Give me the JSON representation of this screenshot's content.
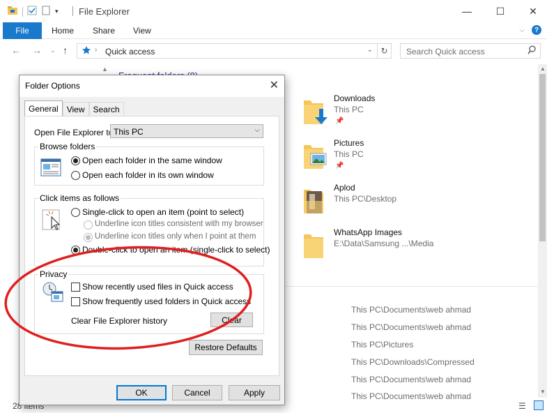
{
  "explorer": {
    "title": "File Explorer",
    "tabs": {
      "file": "File",
      "home": "Home",
      "share": "Share",
      "view": "View"
    },
    "address": "Quick access",
    "search_placeholder": "Search Quick access",
    "section_header": "Frequent folders (8)",
    "folders": [
      {
        "name": "Downloads",
        "path": "This PC",
        "pinned": true
      },
      {
        "name": "Pictures",
        "path": "This PC",
        "pinned": true
      },
      {
        "name": "Aplod",
        "path": "This PC\\Desktop",
        "pinned": false
      },
      {
        "name": "WhatsApp Images",
        "path": "E:\\Data\\Samsung ...\\Media",
        "pinned": false
      }
    ],
    "recent_paths": [
      "This PC\\Documents\\web ahmad",
      "This PC\\Documents\\web ahmad",
      "This PC\\Pictures",
      "This PC\\Downloads\\Compressed",
      "This PC\\Documents\\web ahmad",
      "This PC\\Documents\\web ahmad"
    ],
    "status": "28 items"
  },
  "dialog": {
    "title": "Folder Options",
    "tabs": [
      "General",
      "View",
      "Search"
    ],
    "active_tab": "General",
    "open_label": "Open File Explorer to:",
    "open_value": "This PC",
    "browse": {
      "label": "Browse folders",
      "opt1": "Open each folder in the same window",
      "opt2": "Open each folder in its own window",
      "selected": 1
    },
    "click": {
      "label": "Click items as follows",
      "single": "Single-click to open an item (point to select)",
      "underline1": "Underline icon titles consistent with my browser",
      "underline2": "Underline icon titles only when I point at them",
      "double": "Double-click to open an item (single-click to select)",
      "selected": "double"
    },
    "privacy": {
      "label": "Privacy",
      "recent_files": "Show recently used files in Quick access",
      "frequent_folders": "Show frequently used folders in Quick access",
      "recent_checked": false,
      "frequent_checked": false,
      "clear_history": "Clear File Explorer history",
      "clear_button": "Clear"
    },
    "restore_defaults": "Restore Defaults",
    "ok": "OK",
    "cancel": "Cancel",
    "apply": "Apply"
  },
  "colors": {
    "accent": "#1979ca",
    "annotation": "#e01e1e",
    "folder": "#f4c55a"
  }
}
